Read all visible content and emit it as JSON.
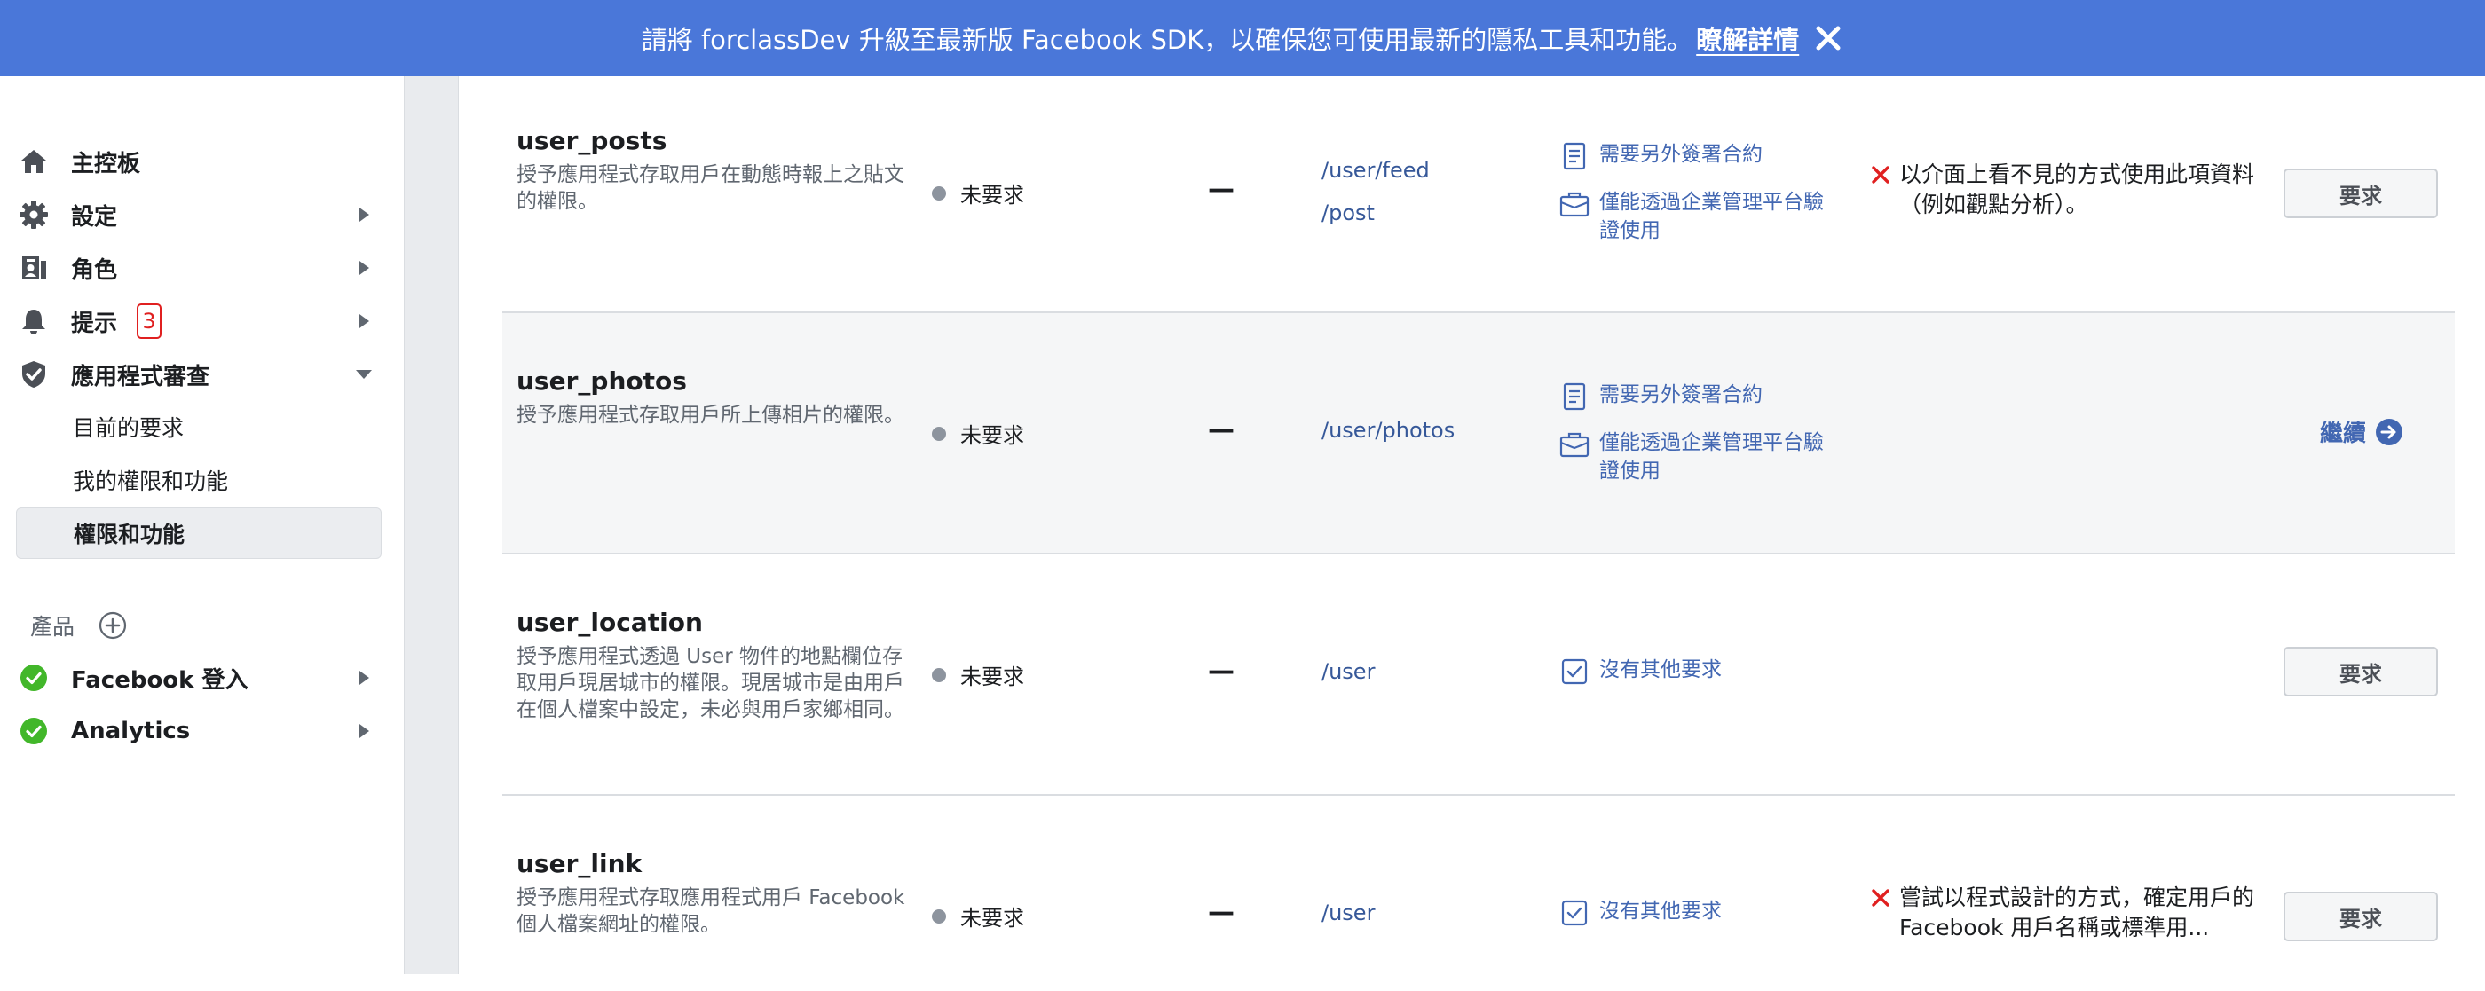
{
  "banner": {
    "message": "請將 forclassDev 升級至最新版 Facebook SDK，以確保您可使用最新的隱私工具和功能。",
    "link": "瞭解詳情",
    "close_icon": "close-icon"
  },
  "sidebar": {
    "items": [
      {
        "label": "主控板",
        "icon": "home-icon"
      },
      {
        "label": "設定",
        "icon": "gear-icon"
      },
      {
        "label": "角色",
        "icon": "roles-icon"
      },
      {
        "label": "提示",
        "icon": "bell-icon",
        "badge": "3"
      },
      {
        "label": "應用程式審查",
        "icon": "shield-check-icon"
      }
    ],
    "subitems": [
      {
        "label": "目前的要求"
      },
      {
        "label": "我的權限和功能"
      },
      {
        "label": "權限和功能",
        "active": true
      }
    ],
    "products_label": "產品",
    "products": [
      {
        "label": "Facebook 登入",
        "icon": "check-circle-icon"
      },
      {
        "label": "Analytics",
        "icon": "check-circle-icon"
      }
    ]
  },
  "permissions": [
    {
      "name": "user_posts",
      "description": "授予應用程式存取用戶在動態時報上之貼文的權限。",
      "status": "未要求",
      "dash": "—",
      "endpoints": [
        "/user/feed",
        "/post"
      ],
      "requirements": [
        "需要另外簽署合約",
        "僅能透過企業管理平台驗證使用"
      ],
      "note": "以介面上看不見的方式使用此項資料（例如觀點分析）。",
      "action": "要求"
    },
    {
      "name": "user_photos",
      "description": "授予應用程式存取用戶所上傳相片的權限。",
      "status": "未要求",
      "dash": "—",
      "endpoints": [
        "/user/photos"
      ],
      "requirements": [
        "需要另外簽署合約",
        "僅能透過企業管理平台驗證使用"
      ],
      "note": "",
      "action": "繼續"
    },
    {
      "name": "user_location",
      "description": "授予應用程式透過 User 物件的地點欄位存取用戶現居城市的權限。現居城市是由用戶在個人檔案中設定，未必與用戶家鄉相同。",
      "status": "未要求",
      "dash": "—",
      "endpoints": [
        "/user"
      ],
      "requirements": [
        "沒有其他要求"
      ],
      "note": "",
      "action": "要求"
    },
    {
      "name": "user_link",
      "description": "授予應用程式存取應用程式用戶 Facebook 個人檔案網址的權限。",
      "status": "未要求",
      "dash": "—",
      "endpoints": [
        "/user"
      ],
      "requirements": [
        "沒有其他要求"
      ],
      "note": "嘗試以程式設計的方式，確定用戶的 Facebook 用戶名稱或標準用...",
      "action": "要求"
    }
  ],
  "colors": {
    "banner": "#4a77d9",
    "link": "#4267b2",
    "success": "#42b72a",
    "error": "#e02020"
  }
}
